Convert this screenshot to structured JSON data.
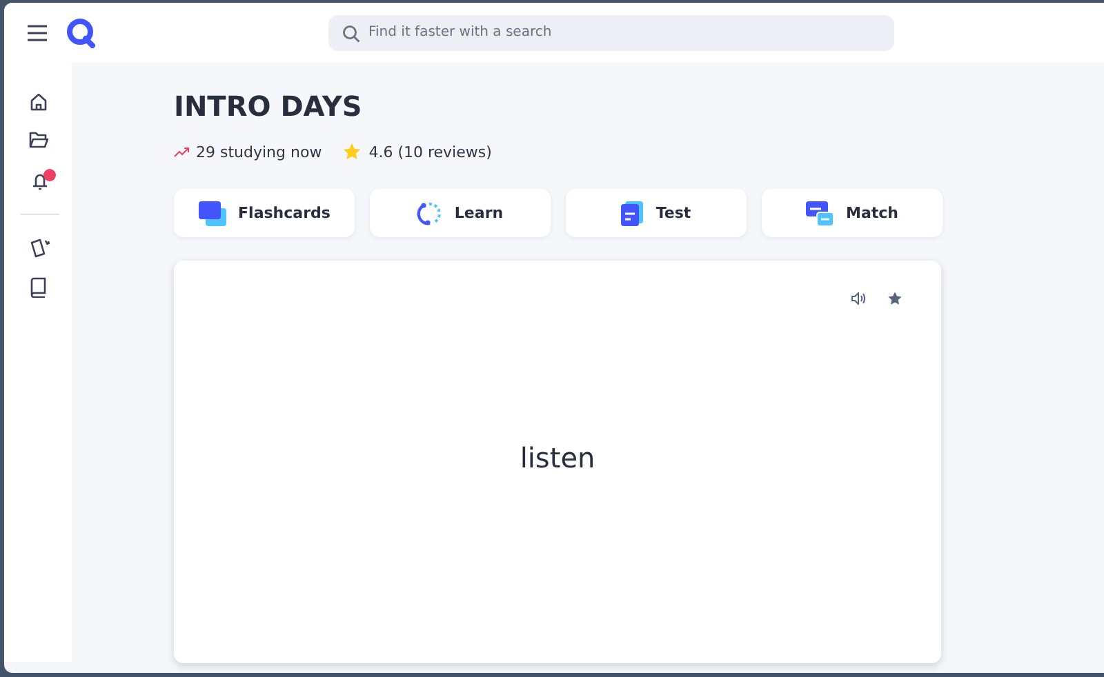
{
  "search": {
    "placeholder": "Find it faster with a search"
  },
  "sidebar": {
    "items": [
      {
        "kind": "home"
      },
      {
        "kind": "folder"
      },
      {
        "kind": "bell",
        "unread": true
      },
      {
        "kind": "cards"
      },
      {
        "kind": "book"
      }
    ]
  },
  "set": {
    "title": "INTRO DAYS",
    "studying": "29 studying now",
    "rating": "4.6 (10 reviews)"
  },
  "modes": [
    {
      "kind": "flashcards",
      "label": "Flashcards"
    },
    {
      "kind": "learn",
      "label": "Learn"
    },
    {
      "kind": "test",
      "label": "Test"
    },
    {
      "kind": "match",
      "label": "Match"
    }
  ],
  "card": {
    "term": "listen",
    "starred": false
  }
}
